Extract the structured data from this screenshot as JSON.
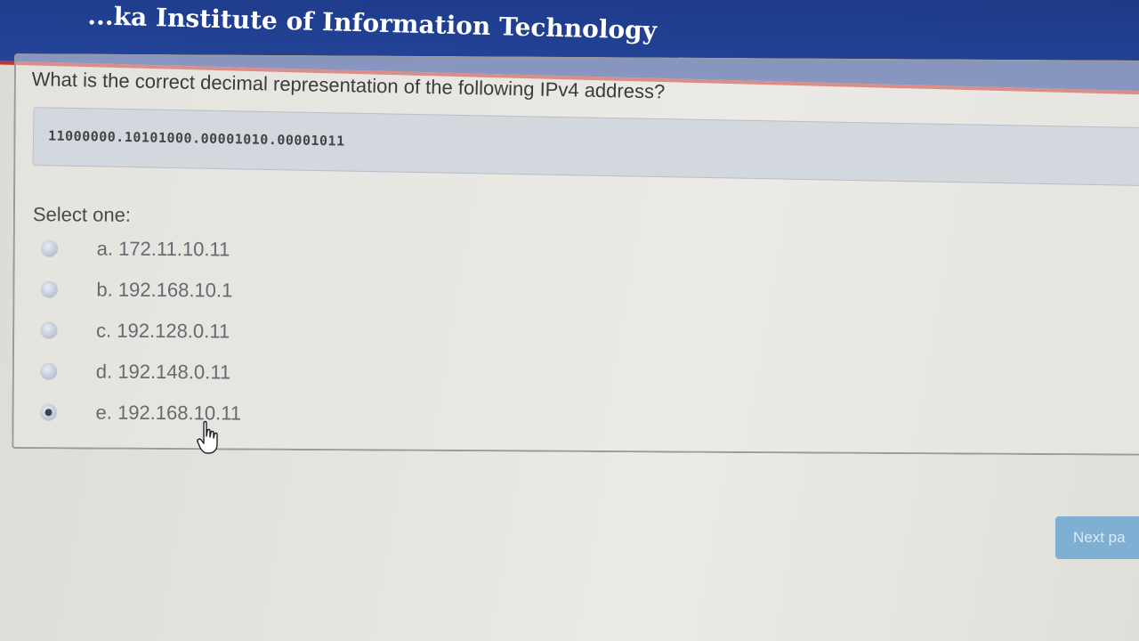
{
  "header": {
    "title": "Sri Lanka Institute of Information Technology",
    "title_visible": "...ka Institute of Information Technology"
  },
  "question": {
    "text": "What is the correct decimal representation of the following IPv4 address?",
    "binary_address": "11000000.10101000.00001010.00001011",
    "select_label": "Select one:",
    "options": [
      {
        "label": "a. 172.11.10.11",
        "selected": false
      },
      {
        "label": "b. 192.168.10.1",
        "selected": false
      },
      {
        "label": "c. 192.128.0.11",
        "selected": false
      },
      {
        "label": "d. 192.148.0.11",
        "selected": false
      },
      {
        "label": "e. 192.168.10.11",
        "selected": true
      }
    ]
  },
  "navigation": {
    "next_label": "Next pa"
  },
  "icons": {
    "cursor": "hand-pointer-icon"
  },
  "colors": {
    "banner": "#24449a",
    "banner_stripe": "#c8322f",
    "next_button": "#7fb0d3"
  }
}
